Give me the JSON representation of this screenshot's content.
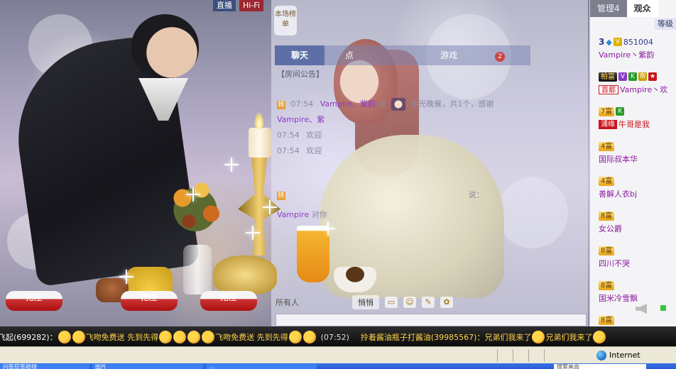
{
  "stage": {
    "badge_live": "直播",
    "badge_hifi": "Hi-Fi",
    "rank_tab": "本场榜单"
  },
  "chat": {
    "tabs": [
      {
        "label": "聊天",
        "active": true
      },
      {
        "label": "点",
        "active": false
      },
      {
        "label": "",
        "active": false
      },
      {
        "label": "游戏",
        "active": false
      },
      {
        "label": "",
        "active": false,
        "count": "2"
      }
    ],
    "notice": "【房间公告】",
    "lines": [
      {
        "icon": "转",
        "time": "07:54",
        "user": "Vampire、紫韵",
        "action": "送",
        "gift": "烛光晚餐，共1个，感谢"
      },
      {
        "user": "Vampire、紫"
      },
      {
        "time": "07:54",
        "text": "欢迎"
      },
      {
        "time": "07:54",
        "text": "欢迎"
      },
      {
        "icon": "转",
        "text": "说："
      },
      {
        "user": "Vampire",
        "text": "对你"
      }
    ],
    "target_label": "所有人",
    "send_button": "悄悄"
  },
  "grab_buttons": [
    "抢座",
    "抢座",
    "抢座"
  ],
  "user_list": {
    "tabs": [
      {
        "label": "管理4",
        "active": false
      },
      {
        "label": "观众",
        "active": true
      }
    ],
    "sub_label": "等级",
    "items": [
      {
        "level": "3",
        "vip": "V",
        "id": "851004",
        "name": "Vampire丶紫韵"
      },
      {
        "rank": "柏富",
        "icons": [
          "V",
          "K",
          "帝",
          "★"
        ],
        "tag": "首都",
        "name": "Vampire丶欢"
      },
      {
        "rank": "7富",
        "icons": [
          "K"
        ],
        "tag": "浦缘",
        "name": "牛哥是我"
      },
      {
        "rank": "4富",
        "name": "国际叔本华"
      },
      {
        "rank": "4富",
        "name": "善解人衣bj"
      },
      {
        "rank": "8富",
        "name": "女公爵"
      },
      {
        "rank": "8富",
        "name": "四川不哭"
      },
      {
        "rank": "8富",
        "name": "国米冷雪飘"
      },
      {
        "rank": "8富",
        "name": ""
      }
    ]
  },
  "ticker": {
    "part1": "飞起(699282)：",
    "part2": "飞吻免费送 先到先得",
    "part3": "飞吻免费送 先到先得",
    "time": "(07:52)",
    "part4": "拎着酱油瓶子打酱油(39985567)：兄弟们我来了",
    "part5": "兄弟们我来了"
  },
  "statusbar": {
    "zone": "Internet"
  },
  "taskbar": {
    "items": [
      "问答应答助理",
      "图片",
      "..."
    ],
    "search": "搜索桌面"
  }
}
